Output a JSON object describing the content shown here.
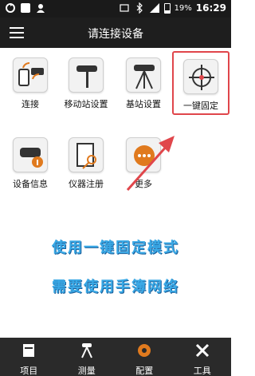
{
  "status_bar": {
    "battery": "19%",
    "time": "16:29"
  },
  "header": {
    "title": "请连接设备"
  },
  "tiles": [
    {
      "label": "连接"
    },
    {
      "label": "移动站设置"
    },
    {
      "label": "基站设置"
    },
    {
      "label": "一键固定"
    },
    {
      "label": "设备信息"
    },
    {
      "label": "仪器注册"
    },
    {
      "label": "更多"
    }
  ],
  "promo": {
    "line1": "使用一键固定模式",
    "line2": "需要使用手簿网络"
  },
  "bottom_nav": [
    {
      "label": "项目"
    },
    {
      "label": "测量"
    },
    {
      "label": "配置"
    },
    {
      "label": "工具"
    }
  ],
  "colors": {
    "accent": "#e07a1e",
    "highlight_border": "#e0464b",
    "promo_text": "#3aa9e6"
  }
}
